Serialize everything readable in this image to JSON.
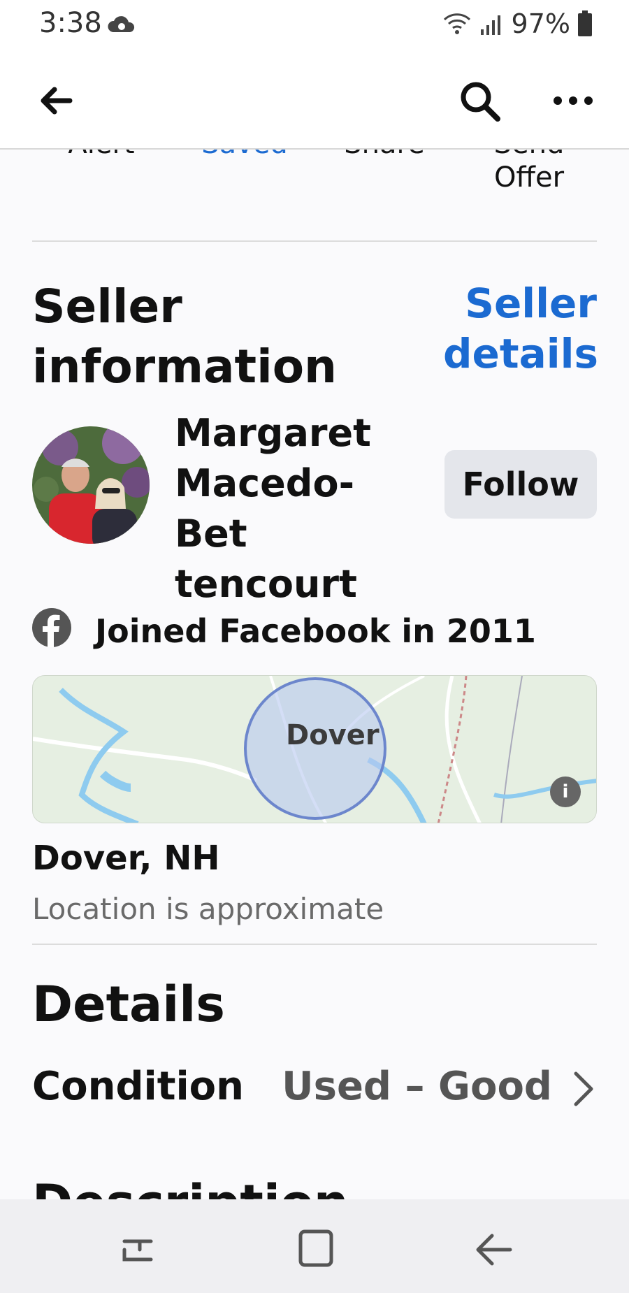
{
  "status_bar": {
    "time": "3:38",
    "battery": "97%"
  },
  "actions": {
    "alert_label": "Alert",
    "saved_label": "Saved",
    "share_label": "Share",
    "offer_label": "Send Offer"
  },
  "seller": {
    "heading": "Seller information",
    "details_link": "Seller details",
    "name": "Margaret Macedo-Bet tencourt",
    "follow_label": "Follow",
    "joined_text": "Joined Facebook in 2011"
  },
  "location": {
    "map_label": "Dover",
    "name": "Dover, NH",
    "note": "Location is approximate"
  },
  "details": {
    "heading": "Details",
    "condition_label": "Condition",
    "condition_value": "Used – Good",
    "description_heading": "Description"
  },
  "colors": {
    "accent": "#1b6ad1",
    "follow_bg": "#e4e6eb",
    "map_bg": "#e6efe2"
  },
  "icons": [
    "cloud-icon",
    "wifi-icon",
    "signal-icon",
    "battery-icon",
    "back-arrow-icon",
    "search-icon",
    "more-icon",
    "facebook-icon",
    "info-icon",
    "chevron-right-icon",
    "recent-apps-icon",
    "home-icon",
    "nav-back-icon"
  ]
}
